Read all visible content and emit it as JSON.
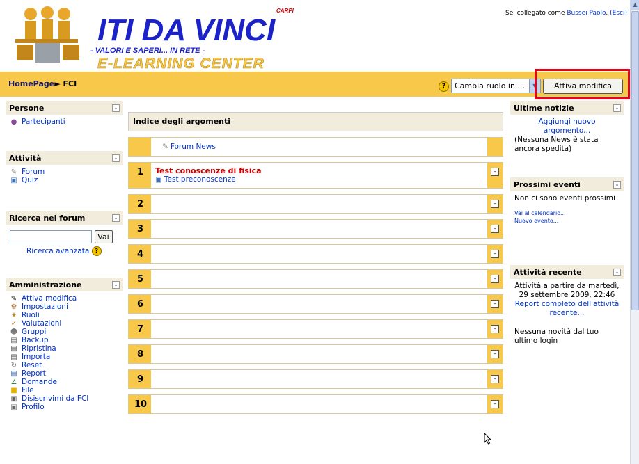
{
  "header": {
    "logo_city": "CARPI",
    "logo_title": "ITI DA VINCI",
    "logo_motto": "- VALORI E SAPERI... IN RETE -",
    "logo_subtitle": "E-LEARNING CENTER",
    "login_prefix": "Sei collegato come ",
    "user_name": "Bussei Paolo",
    "logout_label": "(Esci)"
  },
  "nav": {
    "home_label": "HomePage",
    "separator": "►",
    "course": "FCI",
    "role_select_value": "Cambia ruolo in ...",
    "edit_button": "Attiva modifica"
  },
  "left": {
    "persone": {
      "title": "Persone",
      "items": [
        {
          "label": "Partecipanti",
          "icon": "users-icon"
        }
      ]
    },
    "attivita": {
      "title": "Attività",
      "items": [
        {
          "label": "Forum",
          "icon": "forum-icon"
        },
        {
          "label": "Quiz",
          "icon": "quiz-icon"
        }
      ]
    },
    "ricerca": {
      "title": "Ricerca nei forum",
      "button": "Vai",
      "advanced": "Ricerca avanzata"
    },
    "admin": {
      "title": "Amministrazione",
      "items": [
        {
          "label": "Attiva modifica",
          "icon": "edit-icon"
        },
        {
          "label": "Impostazioni",
          "icon": "settings-icon"
        },
        {
          "label": "Ruoli",
          "icon": "roles-icon"
        },
        {
          "label": "Valutazioni",
          "icon": "grades-icon"
        },
        {
          "label": "Gruppi",
          "icon": "groups-icon"
        },
        {
          "label": "Backup",
          "icon": "backup-icon"
        },
        {
          "label": "Ripristina",
          "icon": "restore-icon"
        },
        {
          "label": "Importa",
          "icon": "import-icon"
        },
        {
          "label": "Reset",
          "icon": "reset-icon"
        },
        {
          "label": "Report",
          "icon": "report-icon"
        },
        {
          "label": "Domande",
          "icon": "questions-icon"
        },
        {
          "label": "File",
          "icon": "folder-icon"
        },
        {
          "label": "Disiscrivimi da FCI",
          "icon": "unenrol-icon"
        },
        {
          "label": "Profilo",
          "icon": "profile-icon"
        }
      ]
    }
  },
  "center": {
    "title": "Indice degli argomenti",
    "news_label": "Forum News",
    "sections": [
      {
        "num": "1",
        "title": "Test conoscenze di fisica",
        "activity": "Test preconoscenze"
      },
      {
        "num": "2"
      },
      {
        "num": "3"
      },
      {
        "num": "4"
      },
      {
        "num": "5"
      },
      {
        "num": "6"
      },
      {
        "num": "7"
      },
      {
        "num": "8"
      },
      {
        "num": "9"
      },
      {
        "num": "10"
      }
    ]
  },
  "right": {
    "news": {
      "title": "Ultime notizie",
      "add_link": "Aggiungi nuovo argomento...",
      "empty": "(Nessuna News è stata ancora spedita)"
    },
    "events": {
      "title": "Prossimi eventi",
      "empty": "Non ci sono eventi prossimi",
      "calendar_link": "Vai al calendario...",
      "new_event_link": "Nuovo evento..."
    },
    "recent": {
      "title": "Attività recente",
      "since": "Attività a partire da martedì, 29 settembre 2009, 22:46",
      "full_report": "Report completo dell'attività recente...",
      "empty": "Nessuna novità dal tuo ultimo login"
    }
  },
  "colors": {
    "accent": "#f7c84a",
    "block_header": "#f1ecdc",
    "highlight": "#e8001c",
    "link": "#0033cc",
    "section_title": "#cc0000"
  }
}
